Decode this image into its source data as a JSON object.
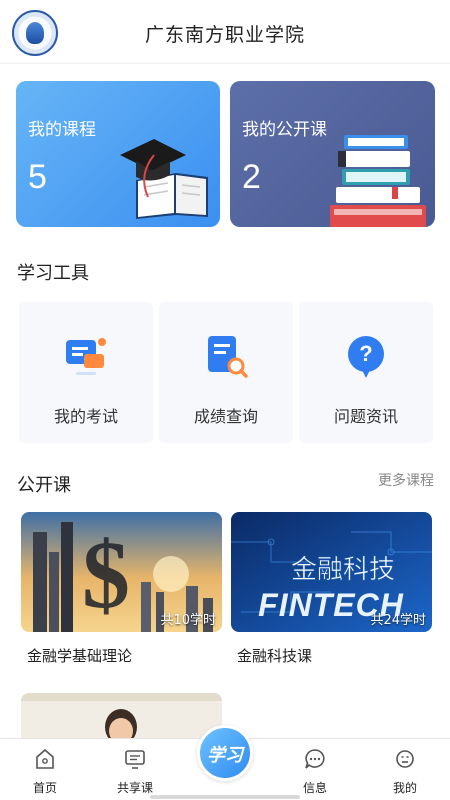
{
  "header": {
    "title": "广东南方职业学院"
  },
  "cards": {
    "my_courses": {
      "title": "我的课程",
      "count": "5"
    },
    "my_open_courses": {
      "title": "我的公开课",
      "count": "2"
    }
  },
  "tools_section": {
    "title": "学习工具"
  },
  "tools": [
    {
      "label": "我的考试",
      "icon": "exam-icon",
      "color": "#2f7df0"
    },
    {
      "label": "成绩查询",
      "icon": "grade-search-icon",
      "color": "#2f7df0"
    },
    {
      "label": "问题资讯",
      "icon": "question-icon",
      "color": "#2f7df0"
    }
  ],
  "open_section": {
    "title": "公开课",
    "more": "更多课程"
  },
  "courses": [
    {
      "name": "金融学基础理论",
      "hours": "共10学时",
      "image": "finance-skyline-dollar"
    },
    {
      "name": "金融科技课",
      "hours": "共24学时",
      "image_text": "金融科技",
      "image_subtext": "FINTECH"
    }
  ],
  "nav": [
    {
      "label": "首页",
      "icon": "home-icon"
    },
    {
      "label": "共享课",
      "icon": "shared-course-icon"
    },
    {
      "center_label": "学习",
      "icon": "study-button"
    },
    {
      "label": "信息",
      "icon": "message-icon"
    },
    {
      "label": "我的",
      "icon": "profile-icon"
    }
  ],
  "colors": {
    "accent": "#2f7df0",
    "card_blue": "#3b8ff0",
    "card_navy": "#4a5a93"
  }
}
